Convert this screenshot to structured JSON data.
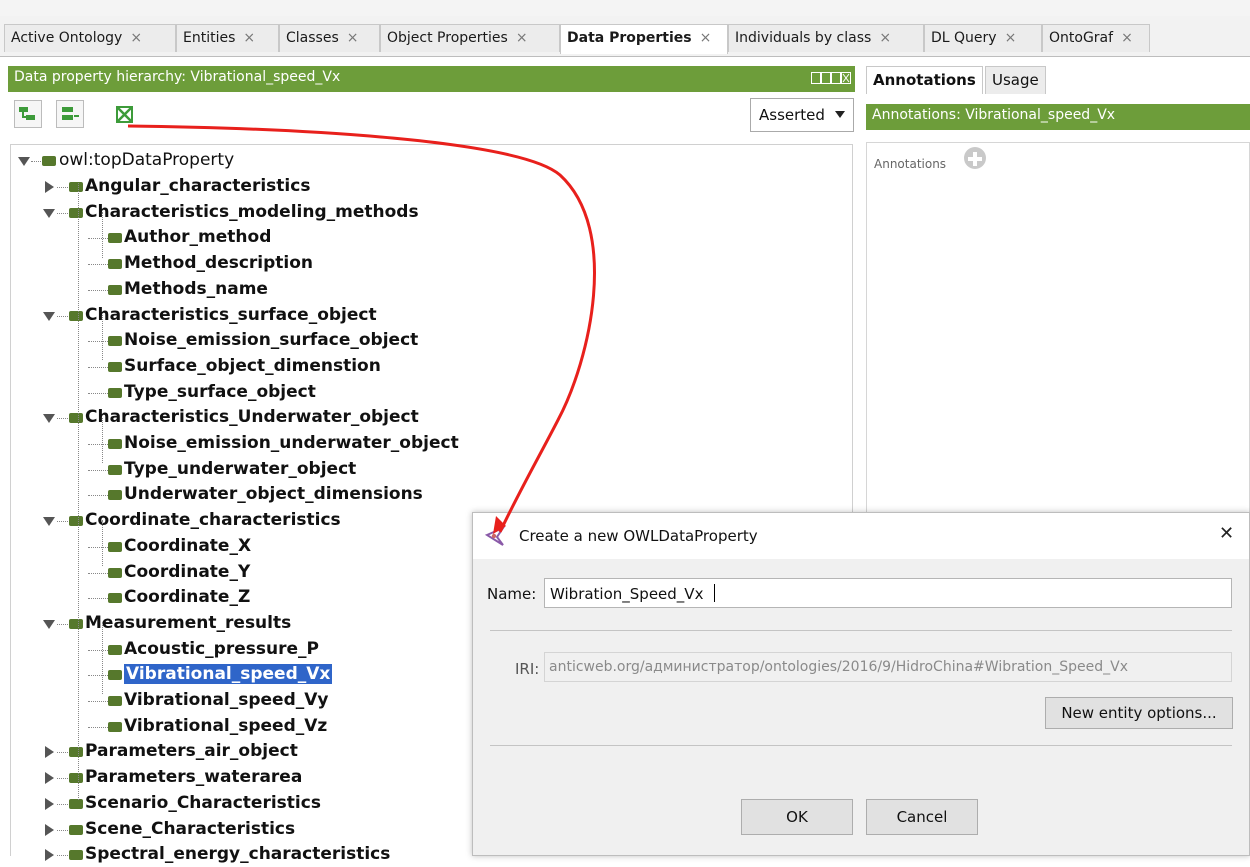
{
  "tabs": [
    {
      "label": "Active Ontology",
      "active": false
    },
    {
      "label": "Entities",
      "active": false
    },
    {
      "label": "Classes",
      "active": false
    },
    {
      "label": "Object Properties",
      "active": false
    },
    {
      "label": "Data Properties",
      "active": true
    },
    {
      "label": "Individuals by class",
      "active": false
    },
    {
      "label": "DL Query",
      "active": false
    },
    {
      "label": "OntoGraf",
      "active": false
    }
  ],
  "hierarchy": {
    "title": "Data property hierarchy: Vibrational_speed_Vx",
    "view_select": "Asserted",
    "icons": [
      "add-subproperty-icon",
      "add-sibling-property-icon",
      "delete-property-icon"
    ],
    "root": "owl:topDataProperty",
    "items": [
      {
        "label": "Angular_characteristics",
        "state": "collapsed"
      },
      {
        "label": "Characteristics_modeling_methods",
        "state": "expanded"
      },
      {
        "label": "Author_method",
        "state": "leaf"
      },
      {
        "label": "Method_description",
        "state": "leaf"
      },
      {
        "label": "Methods_name",
        "state": "leaf"
      },
      {
        "label": "Characteristics_surface_object",
        "state": "expanded"
      },
      {
        "label": "Noise_emission_surface_object",
        "state": "leaf"
      },
      {
        "label": "Surface_object_dimenstion",
        "state": "leaf"
      },
      {
        "label": "Type_surface_object",
        "state": "leaf"
      },
      {
        "label": "Characteristics_Underwater_object",
        "state": "expanded"
      },
      {
        "label": "Noise_emission_underwater_object",
        "state": "leaf"
      },
      {
        "label": "Type_underwater_object",
        "state": "leaf"
      },
      {
        "label": "Underwater_object_dimensions",
        "state": "leaf"
      },
      {
        "label": "Coordinate_characteristics",
        "state": "expanded"
      },
      {
        "label": "Coordinate_X",
        "state": "leaf"
      },
      {
        "label": "Coordinate_Y",
        "state": "leaf"
      },
      {
        "label": "Coordinate_Z",
        "state": "leaf"
      },
      {
        "label": "Measurement_results",
        "state": "expanded"
      },
      {
        "label": "Acoustic_pressure_P",
        "state": "leaf"
      },
      {
        "label": "Vibrational_speed_Vx",
        "state": "leaf",
        "selected": true
      },
      {
        "label": "Vibrational_speed_Vy",
        "state": "leaf"
      },
      {
        "label": "Vibrational_speed_Vz",
        "state": "leaf"
      },
      {
        "label": "Parameters_air_object",
        "state": "collapsed"
      },
      {
        "label": "Parameters_waterarea",
        "state": "collapsed"
      },
      {
        "label": "Scenario_Characteristics",
        "state": "collapsed"
      },
      {
        "label": "Scene_Characteristics",
        "state": "collapsed"
      },
      {
        "label": "Spectral_energy_characteristics",
        "state": "collapsed"
      }
    ]
  },
  "annotations": {
    "tabs": [
      "Annotations",
      "Usage"
    ],
    "header": "Annotations: Vibrational_speed_Vx",
    "label": "Annotations"
  },
  "dialog": {
    "title": "Create a new OWLDataProperty",
    "name_label": "Name:",
    "name_value": "Wibration_Speed_Vx",
    "iri_label": "IRI:",
    "iri_value": "anticweb.org/администратор/ontologies/2016/9/HidroChina#Wibration_Speed_Vx",
    "options_button": "New entity options...",
    "ok_button": "OK",
    "cancel_button": "Cancel",
    "close_glyph": "✕"
  },
  "colors": {
    "header_green": "#6d9d3a",
    "selection_blue": "#2f65c9",
    "annotation_arrow": "#e8201c"
  }
}
